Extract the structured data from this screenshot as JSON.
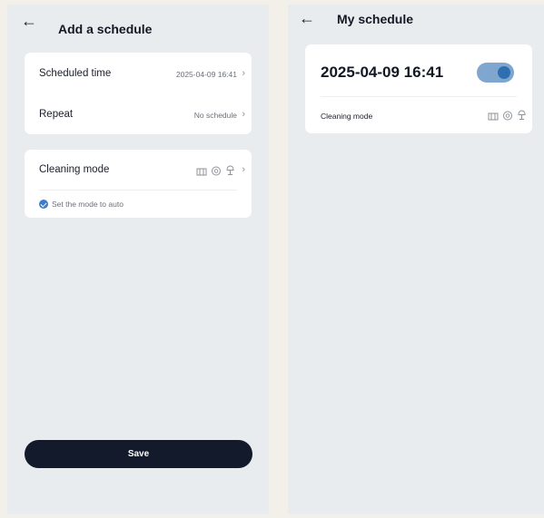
{
  "add_schedule": {
    "title": "Add a schedule",
    "scheduled_time_label": "Scheduled time",
    "scheduled_time_value": "2025-04-09 16:41",
    "repeat_label": "Repeat",
    "repeat_value": "No schedule",
    "cleaning_mode_label": "Cleaning mode",
    "auto_note": "Set the mode to auto",
    "save_label": "Save",
    "icons": [
      "back-arrow-icon",
      "chevron-right-icon",
      "vacuum-icon",
      "sweep-icon",
      "mop-icon",
      "check-circle-icon"
    ]
  },
  "my_schedule": {
    "title": "My schedule",
    "time": "2025-04-09 16:41",
    "enabled": true,
    "cleaning_mode_label": "Cleaning mode"
  },
  "colors": {
    "accent": "#3d7cc9",
    "toggle_track": "#7fa6cf",
    "toggle_knob": "#2f6fb0",
    "save_button": "#121a2b",
    "screen_bg": "#e9ecef",
    "card_bg": "#ffffff"
  }
}
